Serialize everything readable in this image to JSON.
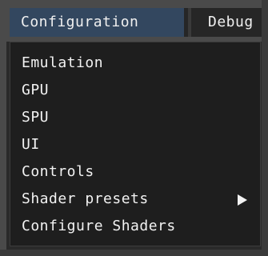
{
  "menubar": {
    "items": [
      {
        "label": "Configuration",
        "active": true
      },
      {
        "label": "Debug",
        "active": false
      }
    ]
  },
  "dropdown": {
    "items": [
      {
        "label": "Emulation"
      },
      {
        "label": "GPU"
      },
      {
        "label": "SPU"
      },
      {
        "label": "UI"
      },
      {
        "label": "Controls"
      },
      {
        "label": "Shader presets",
        "has_submenu": true,
        "submenu_icon": "triangle-right-icon"
      },
      {
        "label": "Configure Shaders"
      }
    ]
  },
  "colors": {
    "menubar_bg": "#262626",
    "active_menu_bg": "#33475f",
    "dropdown_bg": "#1e1e1e",
    "text": "#f2f2f2"
  }
}
